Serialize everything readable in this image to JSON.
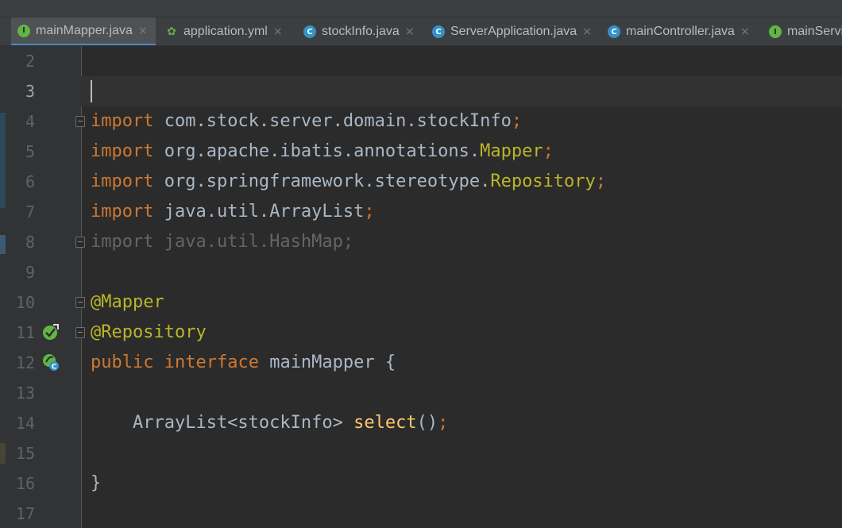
{
  "tabs": [
    {
      "label": "mainMapper.java",
      "icon": "interface-icon",
      "active": true,
      "closable": true
    },
    {
      "label": "application.yml",
      "icon": "yml-icon",
      "active": false,
      "closable": true
    },
    {
      "label": "stockInfo.java",
      "icon": "class-icon",
      "active": false,
      "closable": true
    },
    {
      "label": "ServerApplication.java",
      "icon": "spring-app-icon",
      "active": false,
      "closable": true
    },
    {
      "label": "mainController.java",
      "icon": "class-icon",
      "active": false,
      "closable": true
    },
    {
      "label": "mainServi",
      "icon": "interface-icon",
      "active": false,
      "closable": false
    }
  ],
  "editor": {
    "current_line": 3,
    "lines": [
      {
        "number": "2",
        "text": ""
      },
      {
        "number": "3",
        "text": ""
      },
      {
        "number": "4",
        "kw": "import",
        "text": " com.stock.server.domain.stockInfo",
        "end": ";"
      },
      {
        "number": "5",
        "kw": "import",
        "text": " org.apache.ibatis.annotations.",
        "hl": "Mapper",
        "end": ";"
      },
      {
        "number": "6",
        "kw": "import",
        "text": " org.springframework.stereotype.",
        "hl": "Repository",
        "end": ";"
      },
      {
        "number": "7",
        "kw": "import",
        "text": " java.util.ArrayList",
        "end": ";"
      },
      {
        "number": "8",
        "text": "import java.util.HashMap;"
      },
      {
        "number": "9",
        "text": ""
      },
      {
        "number": "10",
        "text": "@Mapper"
      },
      {
        "number": "11",
        "text": "@Repository"
      },
      {
        "number": "12",
        "kw1": "public",
        "kw2": "interface",
        "text": " mainMapper {"
      },
      {
        "number": "13",
        "text": ""
      },
      {
        "number": "14",
        "pre": "    ArrayList<stockInfo> ",
        "fn": "select",
        "post": "()",
        "end": ";"
      },
      {
        "number": "15",
        "text": ""
      },
      {
        "number": "16",
        "text": "}"
      },
      {
        "number": "17",
        "text": ""
      }
    ]
  },
  "colors": {
    "keyword": "#cc7832",
    "annotation": "#bbb529",
    "method": "#ffc66d",
    "text": "#a9b7c6",
    "unused": "#656565",
    "background": "#2b2b2b",
    "gutter": "#313335",
    "active_tab_underline": "#4a88c7"
  }
}
